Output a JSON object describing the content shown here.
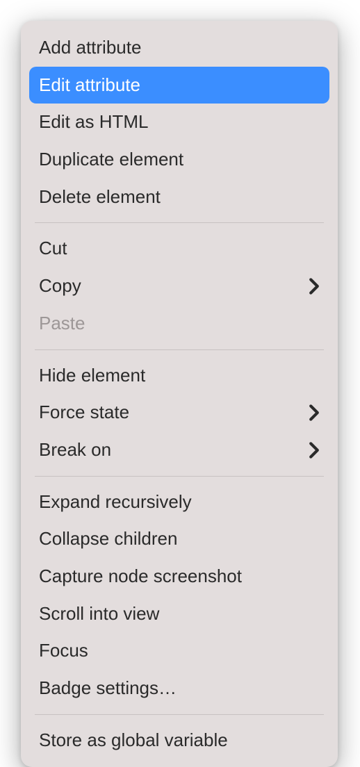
{
  "menu": {
    "groups": [
      {
        "items": [
          {
            "id": "add-attribute",
            "label": "Add attribute",
            "submenu": false,
            "disabled": false,
            "highlighted": false
          },
          {
            "id": "edit-attribute",
            "label": "Edit attribute",
            "submenu": false,
            "disabled": false,
            "highlighted": true
          },
          {
            "id": "edit-as-html",
            "label": "Edit as HTML",
            "submenu": false,
            "disabled": false,
            "highlighted": false
          },
          {
            "id": "duplicate-element",
            "label": "Duplicate element",
            "submenu": false,
            "disabled": false,
            "highlighted": false
          },
          {
            "id": "delete-element",
            "label": "Delete element",
            "submenu": false,
            "disabled": false,
            "highlighted": false
          }
        ]
      },
      {
        "items": [
          {
            "id": "cut",
            "label": "Cut",
            "submenu": false,
            "disabled": false,
            "highlighted": false
          },
          {
            "id": "copy",
            "label": "Copy",
            "submenu": true,
            "disabled": false,
            "highlighted": false
          },
          {
            "id": "paste",
            "label": "Paste",
            "submenu": false,
            "disabled": true,
            "highlighted": false
          }
        ]
      },
      {
        "items": [
          {
            "id": "hide-element",
            "label": "Hide element",
            "submenu": false,
            "disabled": false,
            "highlighted": false
          },
          {
            "id": "force-state",
            "label": "Force state",
            "submenu": true,
            "disabled": false,
            "highlighted": false
          },
          {
            "id": "break-on",
            "label": "Break on",
            "submenu": true,
            "disabled": false,
            "highlighted": false
          }
        ]
      },
      {
        "items": [
          {
            "id": "expand-recursively",
            "label": "Expand recursively",
            "submenu": false,
            "disabled": false,
            "highlighted": false
          },
          {
            "id": "collapse-children",
            "label": "Collapse children",
            "submenu": false,
            "disabled": false,
            "highlighted": false
          },
          {
            "id": "capture-node-screenshot",
            "label": "Capture node screenshot",
            "submenu": false,
            "disabled": false,
            "highlighted": false
          },
          {
            "id": "scroll-into-view",
            "label": "Scroll into view",
            "submenu": false,
            "disabled": false,
            "highlighted": false
          },
          {
            "id": "focus",
            "label": "Focus",
            "submenu": false,
            "disabled": false,
            "highlighted": false
          },
          {
            "id": "badge-settings",
            "label": "Badge settings…",
            "submenu": false,
            "disabled": false,
            "highlighted": false
          }
        ]
      },
      {
        "items": [
          {
            "id": "store-as-global-variable",
            "label": "Store as global variable",
            "submenu": false,
            "disabled": false,
            "highlighted": false
          }
        ]
      }
    ]
  },
  "colors": {
    "menu_bg": "#e3dddd",
    "highlight": "#3b8eff",
    "text": "#2a2a2a",
    "disabled_text": "#9d9797",
    "separator": "#c7c1c1"
  }
}
